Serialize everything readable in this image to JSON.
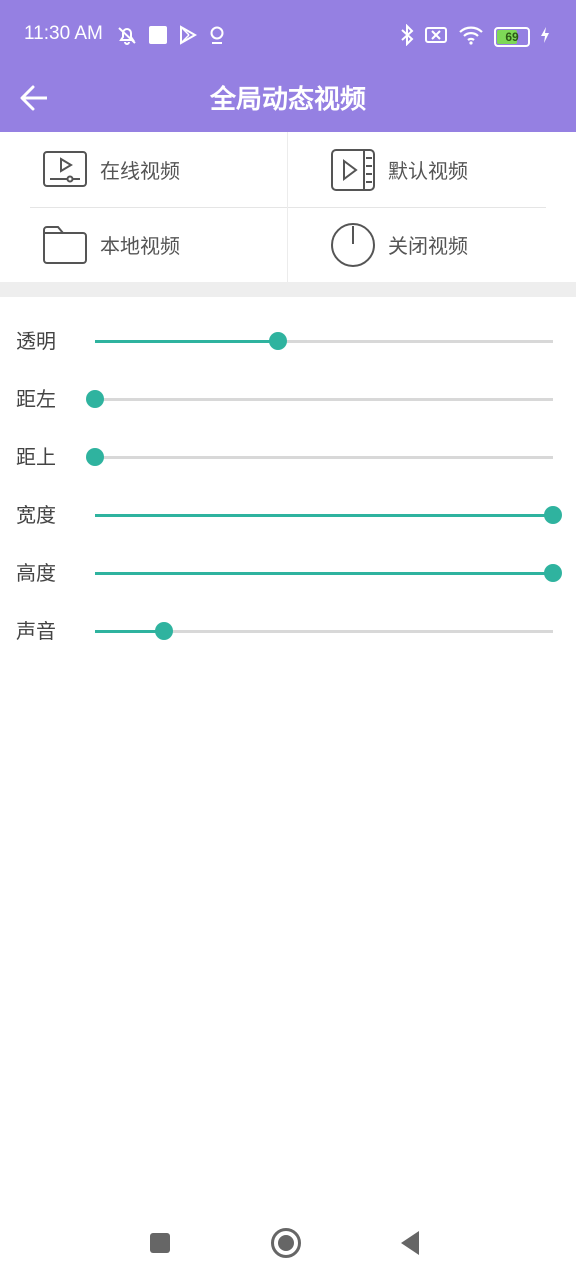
{
  "status_bar": {
    "time": "11:30 AM",
    "battery_level": "69",
    "battery_fraction": 0.69,
    "left_icons": [
      "muted-bell-icon",
      "square-notification-icon",
      "play-store-icon",
      "location-pin-icon"
    ],
    "right_icons": [
      "bluetooth-icon",
      "no-sim-icon",
      "wifi-icon",
      "battery-icon",
      "charging-icon"
    ]
  },
  "app_bar": {
    "title": "全局动态视频",
    "back_icon": "arrow-left-icon",
    "color": "#9580e2"
  },
  "menu": {
    "items": [
      {
        "label": "在线视频",
        "icon": "online-video-icon"
      },
      {
        "label": "默认视频",
        "icon": "default-video-icon"
      },
      {
        "label": "本地视频",
        "icon": "folder-icon"
      },
      {
        "label": "关闭视频",
        "icon": "power-icon"
      }
    ]
  },
  "sliders": [
    {
      "label": "透明",
      "fraction": 0.4
    },
    {
      "label": "距左",
      "fraction": 0.0
    },
    {
      "label": "距上",
      "fraction": 0.0
    },
    {
      "label": "宽度",
      "fraction": 1.0
    },
    {
      "label": "高度",
      "fraction": 1.0
    },
    {
      "label": "声音",
      "fraction": 0.15
    }
  ],
  "accent_color": "#2fb39f",
  "nav_bar": {
    "icons": [
      "recents-square-icon",
      "home-circle-icon",
      "back-triangle-icon"
    ]
  }
}
